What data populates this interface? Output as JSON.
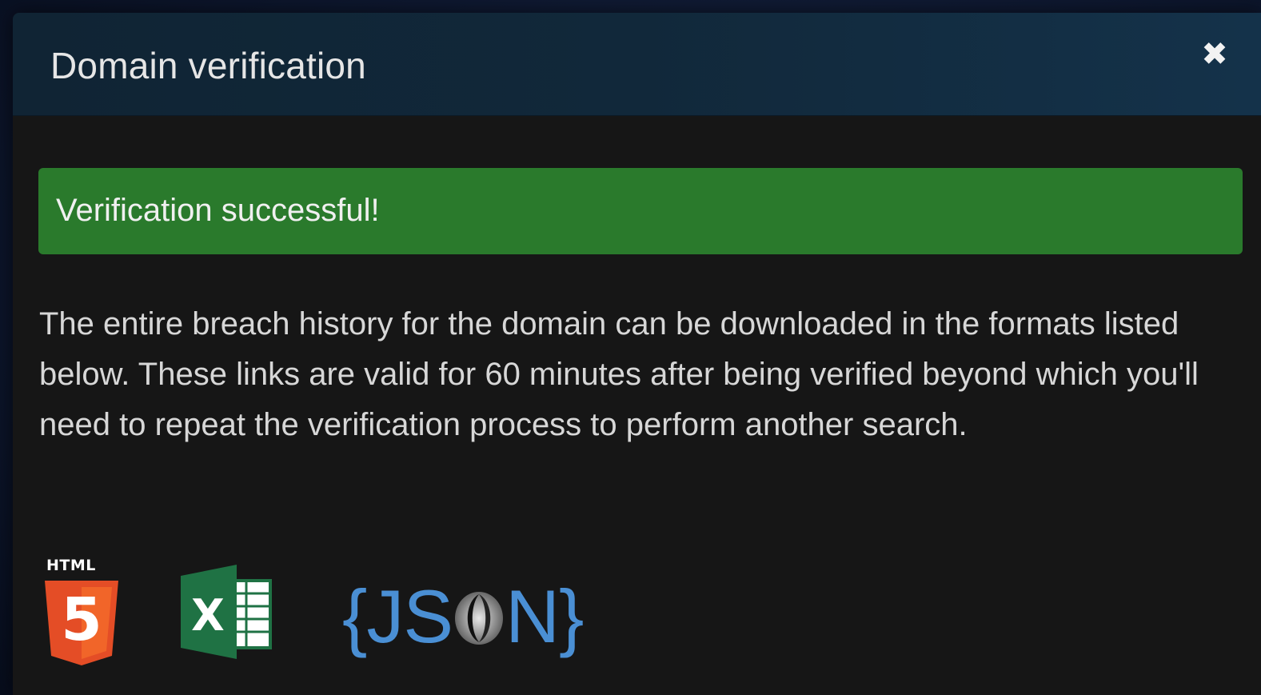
{
  "modal": {
    "title": "Domain verification",
    "close_glyph": "✖"
  },
  "alert": {
    "text": "Verification successful!",
    "color": "#2a7a2c"
  },
  "body": {
    "text": "The entire breach history for the domain can be downloaded in the formats listed below. These links are valid for 60 minutes after being verified beyond which you'll need to repeat the verification process to perform another search."
  },
  "downloads": {
    "html": {
      "label": "HTML",
      "digit": "5",
      "icon": "html5-icon",
      "color": "#e44d26"
    },
    "excel": {
      "letter": "X",
      "icon": "excel-icon",
      "color": "#1f7244"
    },
    "json": {
      "prefix": "{JS",
      "suffix": "N}",
      "icon": "json-icon",
      "color": "#4a8fd4"
    }
  }
}
